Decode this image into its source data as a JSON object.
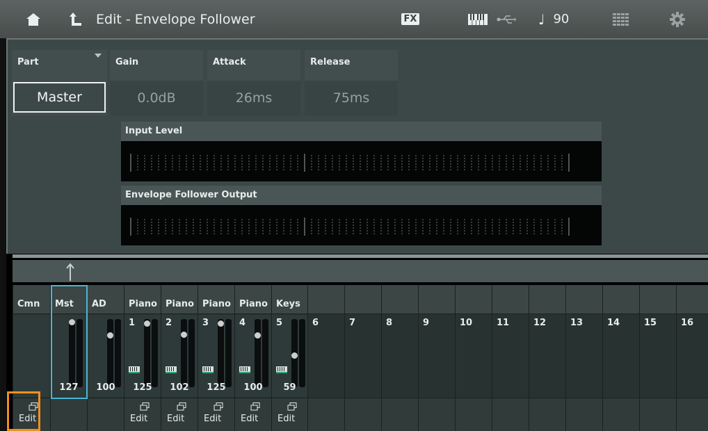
{
  "header": {
    "title": "Edit - Envelope Follower",
    "fx_label": "FX",
    "tempo_note": "♩",
    "tempo": "90"
  },
  "params": {
    "part": {
      "label": "Part",
      "value": "Master"
    },
    "gain": {
      "label": "Gain",
      "value": "0.0dB"
    },
    "attack": {
      "label": "Attack",
      "value": "26ms"
    },
    "release": {
      "label": "Release",
      "value": "75ms"
    }
  },
  "meters": {
    "input_label": "Input Level",
    "output_label": "Envelope Follower Output"
  },
  "mixer": {
    "edit_label": "Edit",
    "channels": [
      {
        "header": "Cmn",
        "num": "",
        "volume": ""
      },
      {
        "header": "Mst",
        "num": "",
        "volume": "127"
      },
      {
        "header": "AD",
        "num": "",
        "volume": "100"
      },
      {
        "header": "Piano",
        "num": "1",
        "volume": "125"
      },
      {
        "header": "Piano",
        "num": "2",
        "volume": "102"
      },
      {
        "header": "Piano",
        "num": "3",
        "volume": "125"
      },
      {
        "header": "Piano",
        "num": "4",
        "volume": "100"
      },
      {
        "header": "Keys",
        "num": "5",
        "volume": "59"
      },
      {
        "header": "",
        "num": "6",
        "volume": ""
      },
      {
        "header": "",
        "num": "7",
        "volume": ""
      },
      {
        "header": "",
        "num": "8",
        "volume": ""
      },
      {
        "header": "",
        "num": "9",
        "volume": ""
      },
      {
        "header": "",
        "num": "10",
        "volume": ""
      },
      {
        "header": "",
        "num": "11",
        "volume": ""
      },
      {
        "header": "",
        "num": "12",
        "volume": ""
      },
      {
        "header": "",
        "num": "13",
        "volume": ""
      },
      {
        "header": "",
        "num": "14",
        "volume": ""
      },
      {
        "header": "",
        "num": "15",
        "volume": ""
      },
      {
        "header": "",
        "num": "16",
        "volume": ""
      }
    ]
  },
  "colors": {
    "selected_outline": "#4ab6d6",
    "cursor_outline": "#f0901e"
  }
}
